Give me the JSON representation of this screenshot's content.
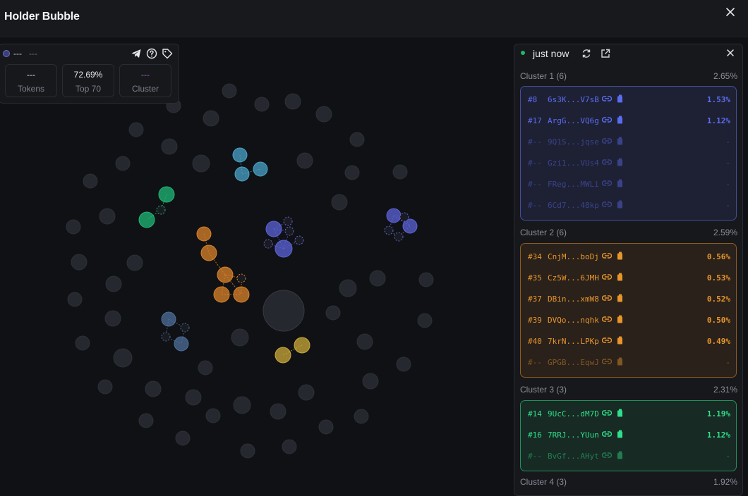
{
  "header": {
    "title": "Holder Bubble"
  },
  "stats": {
    "address": "---",
    "address_suffix": "---",
    "boxes": [
      {
        "value": "---",
        "label": "Tokens"
      },
      {
        "value": "72.69%",
        "label": "Top 70"
      },
      {
        "value": "---",
        "label": "Cluster"
      }
    ]
  },
  "panel": {
    "status": "just now",
    "clusters": [
      {
        "name": "Cluster 1 (6)",
        "pct": "2.65%",
        "color": "#5b6cf0",
        "rows": [
          {
            "rank": "#8",
            "addr": "6s3K...V7sB",
            "pct": "1.53%",
            "dim": false
          },
          {
            "rank": "#17",
            "addr": "ArgG...VQ6g",
            "pct": "1.12%",
            "dim": false
          },
          {
            "rank": "#--",
            "addr": "9Q1S...jqse",
            "pct": "-",
            "dim": true
          },
          {
            "rank": "#--",
            "addr": "Gzi1...VUs4",
            "pct": "-",
            "dim": true
          },
          {
            "rank": "#--",
            "addr": "FReg...MWLi",
            "pct": "-",
            "dim": true
          },
          {
            "rank": "#--",
            "addr": "6Cd7...48kp",
            "pct": "-",
            "dim": true
          }
        ]
      },
      {
        "name": "Cluster 2 (6)",
        "pct": "2.59%",
        "color": "#e8962a",
        "rows": [
          {
            "rank": "#34",
            "addr": "CnjM...boDj",
            "pct": "0.56%",
            "dim": false
          },
          {
            "rank": "#35",
            "addr": "Cz5W...6JMH",
            "pct": "0.53%",
            "dim": false
          },
          {
            "rank": "#37",
            "addr": "DBin...xmW8",
            "pct": "0.52%",
            "dim": false
          },
          {
            "rank": "#39",
            "addr": "DVQo...nqhk",
            "pct": "0.50%",
            "dim": false
          },
          {
            "rank": "#40",
            "addr": "7krN...LPKp",
            "pct": "0.49%",
            "dim": false
          },
          {
            "rank": "#--",
            "addr": "GPGB...EqwJ",
            "pct": "-",
            "dim": true
          }
        ]
      },
      {
        "name": "Cluster 3 (3)",
        "pct": "2.31%",
        "color": "#2ee08a",
        "rows": [
          {
            "rank": "#14",
            "addr": "9UcC...dM7D",
            "pct": "1.19%",
            "dim": false
          },
          {
            "rank": "#16",
            "addr": "7RRJ...YUun",
            "pct": "1.12%",
            "dim": false
          },
          {
            "rank": "#--",
            "addr": "BvGf...AHyt",
            "pct": "-",
            "dim": true
          }
        ]
      },
      {
        "name": "Cluster 4 (3)",
        "pct": "1.92%",
        "color": "#46a7c8",
        "rows": []
      }
    ]
  },
  "graph": {
    "clusters": [
      {
        "name": "cluster-1",
        "color": "#5b63d6"
      },
      {
        "name": "cluster-2",
        "color": "#d9832a"
      },
      {
        "name": "cluster-3",
        "color": "#1fb877"
      },
      {
        "name": "cluster-4",
        "color": "#4aa3c8"
      },
      {
        "name": "cluster-5",
        "color": "#4d6f9a"
      },
      {
        "name": "cluster-6",
        "color": "#c9a93a"
      }
    ]
  }
}
